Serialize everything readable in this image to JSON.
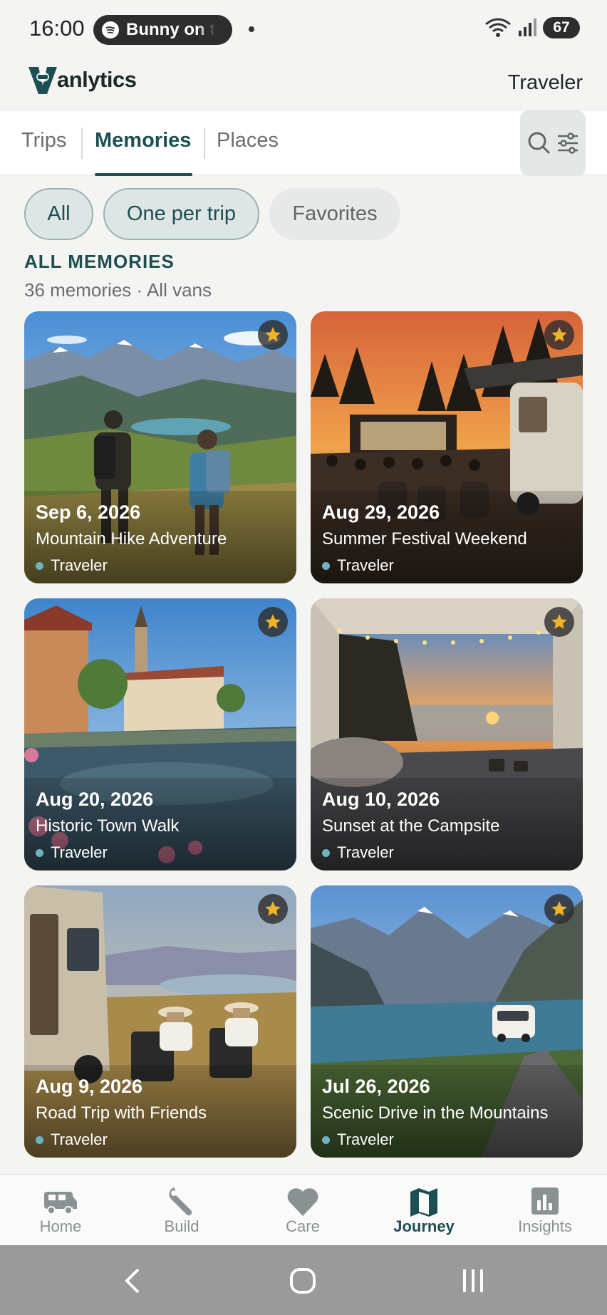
{
  "status_bar": {
    "time": "16:00",
    "media_text": "Bunny on t",
    "battery": "67"
  },
  "header": {
    "brand": "anlytics",
    "user": "Traveler"
  },
  "tabs": [
    {
      "label": "Trips",
      "active": false
    },
    {
      "label": "Memories",
      "active": true
    },
    {
      "label": "Places",
      "active": false
    }
  ],
  "filters": [
    {
      "label": "All",
      "selected": true
    },
    {
      "label": "One per trip",
      "selected": true
    },
    {
      "label": "Favorites",
      "selected": false
    }
  ],
  "section": {
    "title": "ALL MEMORIES",
    "subtitle": "36 memories · All vans"
  },
  "memories": [
    {
      "date": "Sep 6, 2026",
      "title": "Mountain Hike Adventure",
      "owner": "Traveler",
      "favorite": true
    },
    {
      "date": "Aug 29, 2026",
      "title": "Summer Festival Weekend",
      "owner": "Traveler",
      "favorite": true
    },
    {
      "date": "Aug 20, 2026",
      "title": "Historic Town Walk",
      "owner": "Traveler",
      "favorite": true
    },
    {
      "date": "Aug 10, 2026",
      "title": "Sunset at the Campsite",
      "owner": "Traveler",
      "favorite": true
    },
    {
      "date": "Aug 9, 2026",
      "title": "Road Trip with Friends",
      "owner": "Traveler",
      "favorite": true
    },
    {
      "date": "Jul 26, 2026",
      "title": "Scenic Drive in the Mountains",
      "owner": "Traveler",
      "favorite": true
    }
  ],
  "bottom_nav": [
    {
      "label": "Home",
      "icon": "van-icon",
      "active": false
    },
    {
      "label": "Build",
      "icon": "wrench-icon",
      "active": false
    },
    {
      "label": "Care",
      "icon": "heart-icon",
      "active": false
    },
    {
      "label": "Journey",
      "icon": "map-icon",
      "active": true
    },
    {
      "label": "Insights",
      "icon": "bar-chart-icon",
      "active": false
    }
  ],
  "colors": {
    "accent": "#1d4f52",
    "star": "#f0b429",
    "owner_dot": "#6fb3c2"
  }
}
